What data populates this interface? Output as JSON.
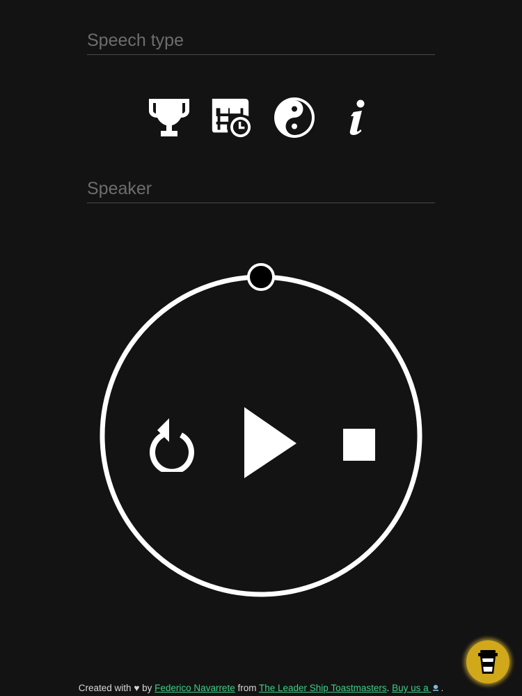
{
  "form": {
    "speech_type_placeholder": "Speech type",
    "speaker_placeholder": "Speaker"
  },
  "speech_icons": [
    {
      "name": "trophy-icon"
    },
    {
      "name": "timetable-icon"
    },
    {
      "name": "yin-yang-icon"
    },
    {
      "name": "info-icon"
    }
  ],
  "timer": {
    "ring_color": "#ffffff",
    "background": "#141314",
    "progress_fraction": 0
  },
  "controls": {
    "reset": "reset-icon",
    "play": "play-icon",
    "stop": "stop-icon"
  },
  "footer": {
    "prefix": "Created with",
    "heart": "♥",
    "by": "by",
    "author": "Federico Navarrete",
    "from": "from",
    "club": "The Leader Ship Toastmasters",
    "sep": ".",
    "donate": "Buy us a",
    "end": "."
  },
  "colors": {
    "link": "#3ccf86",
    "coffee_button": "#d1a81a"
  }
}
